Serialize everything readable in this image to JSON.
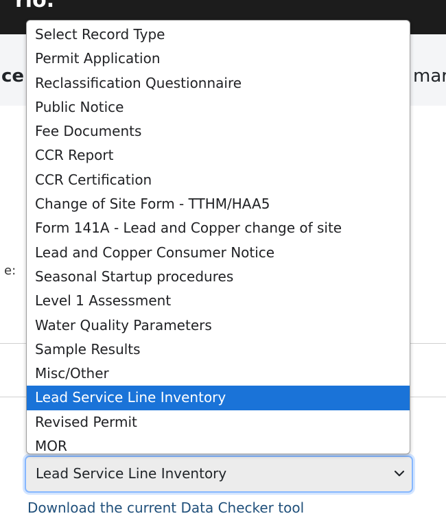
{
  "page": {
    "topbar_fragment": "rio.",
    "heading_left_fragment": "ce",
    "heading_right_fragment": "mar",
    "label_fragment": "e:"
  },
  "dropdown": {
    "options": [
      "Select Record Type",
      "Permit Application",
      "Reclassification Questionnaire",
      "Public Notice",
      "Fee Documents",
      "CCR Report",
      "CCR Certification",
      "Change of Site Form - TTHM/HAA5",
      "Form 141A - Lead and Copper change of site",
      "Lead and Copper Consumer Notice",
      "Seasonal Startup procedures",
      "Level 1 Assessment",
      "Water Quality Parameters",
      "Sample Results",
      "Misc/Other",
      "Lead Service Line Inventory",
      "Revised Permit",
      "MOR"
    ],
    "selected_index": 15,
    "selected_value": "Lead Service Line Inventory",
    "chevron_icon": "chevron-down-icon",
    "highlight_color": "#1a73d8"
  },
  "footer": {
    "download_link_text": "Download the current Data Checker tool"
  }
}
